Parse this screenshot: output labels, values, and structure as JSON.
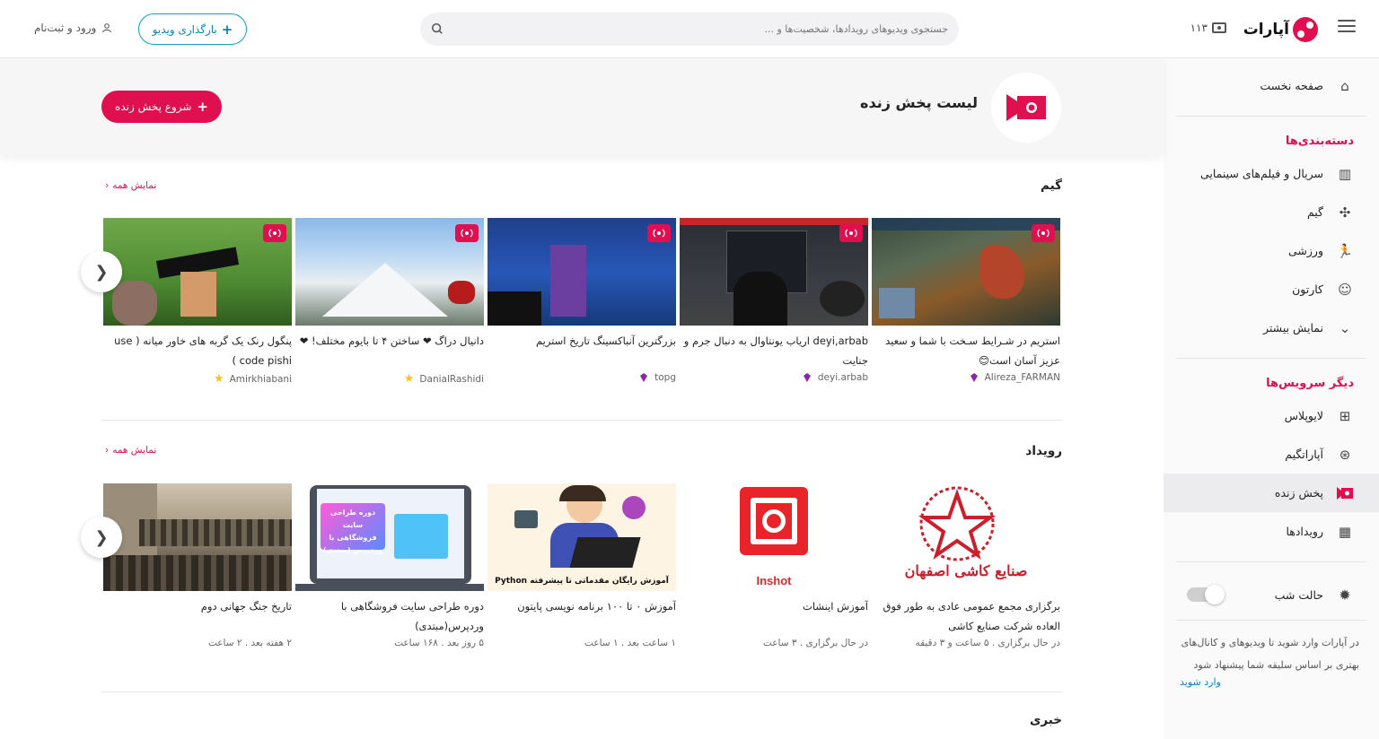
{
  "header": {
    "logo_text": "آپارات",
    "live_count": "۱۱۳",
    "search_placeholder": "جستجوی ویدیوهای رویدادها، شخصیت‌ها و ...",
    "upload_label": "بارگذاری ویدیو",
    "login_label": "ورود و ثبت‌نام"
  },
  "sidebar": {
    "home": "صفحه نخست",
    "categories_head": "دسته‌بندی‌ها",
    "categories": [
      "سریال و فیلم‌های سینمایی",
      "گیم",
      "ورزشی",
      "کارتون",
      "نمایش بیشتر"
    ],
    "services_head": "دیگر سرویس‌ها",
    "services": [
      "لایوپلاس",
      "آپاراتگیم",
      "پخش زنده",
      "رویدادها"
    ],
    "night_mode": "حالت شب",
    "login_prompt": "در آپارات وارد شوید تا ویدیوهای و کانال‌های بهتری بر اساس سلیقه شما پیشنهاد شود",
    "login_link": "وارد شوید"
  },
  "page": {
    "title": "لیست پخش زنده",
    "start_live": "شروع پخش زنده"
  },
  "sections": {
    "game": {
      "title": "گیم",
      "show_all": "نمایش همه",
      "cards": [
        {
          "title": "استریم در شـرایط سـخت با شما و سعید عزیز آسان است😊",
          "channel": "Alireza_FARMAN"
        },
        {
          "title": "deyi,arbab اریاب یونتاوال به دنبال جرم و جنایت",
          "channel": "deyi.arbab"
        },
        {
          "title": "بزرگترین آنباکسینگ تاریخ استریم",
          "channel": "topg"
        },
        {
          "title": "دانیال دراگ ❤ ساختن ۴ تا بایوم مختلف! ❤",
          "channel": "DanialRashidi"
        },
        {
          "title": "پنگول رنک یک گربه های خاور میانه ( use code pishi )",
          "channel": "Amirkhiabani"
        }
      ]
    },
    "event": {
      "title": "رویداد",
      "show_all": "نمایش همه",
      "cards": [
        {
          "title": "برگزاری مجمع عمومی عادی به طور فوق العاده شرکت صنایع کاشی",
          "meta": "در حال برگزاری . ۵ ساعت و ۳ دقیقه"
        },
        {
          "title": "آموزش اینشات",
          "meta": "در حال برگزاری . ۳ ساعت"
        },
        {
          "title": "آموزش ۰ تا ۱۰۰ برنامه نویسی پایتون",
          "meta": "۱ ساعت بعد . ۱ ساعت"
        },
        {
          "title": "دوره طراحی سایت فروشگاهی با وردپرس(مبتدی)",
          "meta": "۵ روز بعد . ۱۶۸ ساعت"
        },
        {
          "title": "تاریخ جنگ جهانی دوم",
          "meta": "۲ هفته بعد . ۲ ساعت"
        }
      ],
      "thumb_texts": {
        "kashi": "صنایع کاشی اصفهان",
        "inshot": "Inshot",
        "python": "آموزش رایگان مقدماتی تا پیشرفته Python",
        "wordpress": "دوره طراحی سایت فروشگاهی با وردپرس (مبتدی)"
      }
    },
    "news": {
      "title": "خبری"
    }
  },
  "colors": {
    "brand": "#df0f50",
    "link": "#0a84b7"
  }
}
